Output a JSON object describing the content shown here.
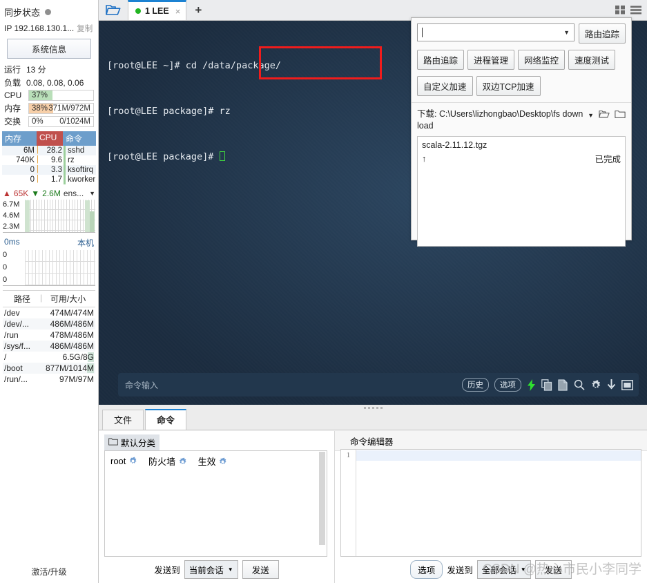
{
  "sidebar": {
    "sync_label": "同步状态",
    "ip_label": "IP 192.168.130.1...",
    "copy_label": "复制",
    "sysinfo_button": "系统信息",
    "uptime_key": "运行",
    "uptime_val": "13 分",
    "load_key": "负载",
    "load_val": "0.08, 0.08, 0.06",
    "cpu_key": "CPU",
    "cpu_pct_text": "37%",
    "cpu_pct": 37,
    "mem_key": "内存",
    "mem_pct_text": "38%",
    "mem_val_text": "371M/972M",
    "mem_pct": 38,
    "swap_key": "交换",
    "swap_pct_text": "0%",
    "swap_val_text": "0/1024M",
    "swap_pct": 0,
    "proc_headers": {
      "mem": "内存",
      "cpu": "CPU",
      "cmd": "命令"
    },
    "processes": [
      {
        "mem": "6M",
        "cpu": "28.2",
        "cmd": "sshd",
        "cpu_bar": 28
      },
      {
        "mem": "740K",
        "cpu": "9.6",
        "cmd": "rz",
        "cpu_bar": 10
      },
      {
        "mem": "0",
        "cpu": "3.3",
        "cmd": "ksoftirq",
        "cpu_bar": 3
      },
      {
        "mem": "0",
        "cpu": "1.7",
        "cmd": "kworker",
        "cpu_bar": 2
      }
    ],
    "net": {
      "up": "65K",
      "down": "2.6M",
      "iface": "ens...",
      "y_labels": [
        "6.7M",
        "4.6M",
        "2.3M"
      ]
    },
    "latency": {
      "value": "0ms",
      "target": "本机",
      "y_labels": [
        "0",
        "0",
        "0"
      ]
    },
    "disk_headers": {
      "path": "路径",
      "size": "可用/大小"
    },
    "disks": [
      {
        "path": "/dev",
        "size": "474M/474M",
        "highlight": false
      },
      {
        "path": "/dev/...",
        "size": "486M/486M",
        "highlight": false
      },
      {
        "path": "/run",
        "size": "478M/486M",
        "highlight": false
      },
      {
        "path": "/sys/f...",
        "size": "486M/486M",
        "highlight": false
      },
      {
        "path": "/",
        "size": "6.5G/8G",
        "highlight": true
      },
      {
        "path": "/boot",
        "size": "877M/1014M",
        "highlight": true
      },
      {
        "path": "/run/...",
        "size": "97M/97M",
        "highlight": false
      }
    ],
    "activate_label": "激活/升级"
  },
  "tabbar": {
    "folder_icon": "open-folder-icon",
    "tab_label": "1 LEE",
    "tab_close": "×",
    "add_label": "+",
    "grid_icon": "grid-view-icon",
    "list_icon": "list-view-icon"
  },
  "terminal": {
    "lines": [
      "[root@LEE ~]# cd /data/package/",
      "[root@LEE package]# rz",
      "[root@LEE package]# "
    ],
    "command_placeholder": "命令输入",
    "history_button": "历史",
    "options_button": "选项",
    "toolbar_icons": [
      "lightning-icon",
      "copy-icon",
      "paste-icon",
      "search-icon",
      "gear-icon",
      "download-icon",
      "window-icon"
    ]
  },
  "float_panel": {
    "combo_value": "",
    "trace_button": "路由追踪",
    "buttons_row1": [
      "路由追踪",
      "进程管理",
      "网络监控",
      "速度测试"
    ],
    "buttons_row2": [
      "自定义加速",
      "双边TCP加速"
    ],
    "download_label": "下载: C:\\Users\\lizhongbao\\Desktop\\fs download",
    "file_name": "scala-2.11.12.tgz",
    "file_status": "已完成"
  },
  "bottom": {
    "tabs": [
      {
        "label": "文件",
        "active": false
      },
      {
        "label": "命令",
        "active": true
      }
    ],
    "category": "默认分类",
    "commands": [
      {
        "label": "root"
      },
      {
        "label": "防火墙"
      },
      {
        "label": "生效"
      }
    ],
    "send_to_label": "发送到",
    "send_to_value": "当前会话",
    "send_button": "发送",
    "editor_title": "命令编辑器",
    "editor_line_number": "1",
    "options_button": "选项",
    "send_to_label2": "发送到",
    "send_to_value2": "全部会话",
    "send_button2": "发送"
  },
  "watermark": "CSDN @热心市民小李同学",
  "colors": {
    "accent": "#1c82d2",
    "terminal_bg": "#1e3045",
    "highlight_red": "#f01c1c",
    "cpu_bar": "#b9dfb9",
    "mem_bar": "#f7cfa8",
    "proc_header": "#6d9ecb",
    "proc_header_cpu": "#c0504d"
  }
}
